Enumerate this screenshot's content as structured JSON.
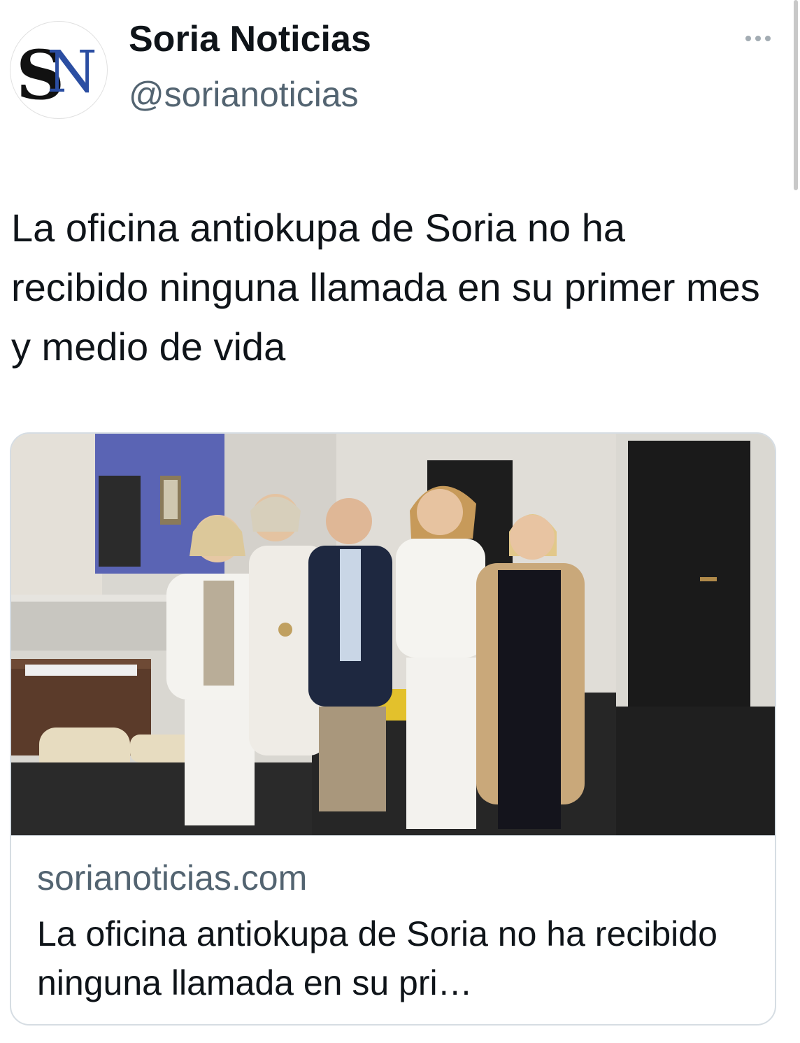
{
  "tweet": {
    "author": {
      "display_name": "Soria Noticias",
      "handle": "@sorianoticias",
      "avatar_logo_text": "SN"
    },
    "text": "La oficina antiokupa de Soria no ha recibido ninguna llamada en su primer mes y medio de vida",
    "more_icon": "more-horizontal-icon"
  },
  "link_card": {
    "domain": "sorianoticias.com",
    "title": "La oficina antiokupa de Soria no ha recibido ninguna llamada en su pri…",
    "image_alt": "Five people standing in an office lobby with marble walls"
  },
  "colors": {
    "text_primary": "#0f1419",
    "text_secondary": "#536471",
    "border": "#d6dde3",
    "logo_s": "#111111",
    "logo_n": "#2b4ea2"
  }
}
